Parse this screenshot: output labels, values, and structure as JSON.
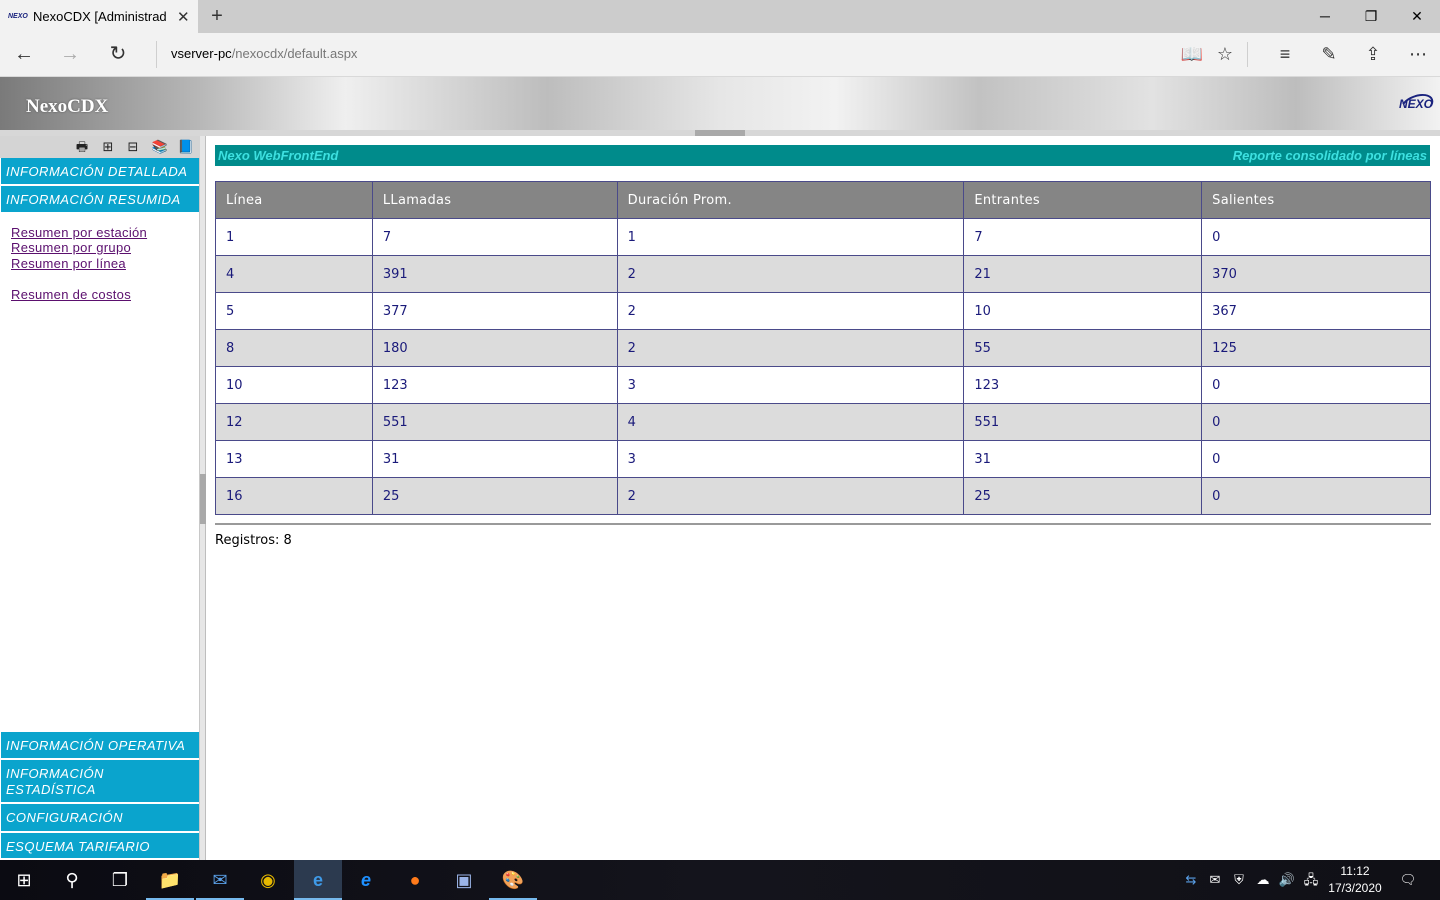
{
  "browser": {
    "tab_title": "NexoCDX [Administrado",
    "tab_favicon_text": "NEXO",
    "url_host": "vserver-pc",
    "url_path": "/nexocdx/default.aspx"
  },
  "header": {
    "app_title": "NexoCDX",
    "logo_text": "NEXO"
  },
  "sidebar": {
    "menu_top": [
      {
        "label": "INFORMACIÓN DETALLADA"
      },
      {
        "label": "INFORMACIÓN RESUMIDA"
      }
    ],
    "links": [
      {
        "label": "Resumen por estación"
      },
      {
        "label": "Resumen por grupo"
      },
      {
        "label": "Resumen por línea"
      },
      {
        "label": "Resumen de costos"
      }
    ],
    "menu_bottom": [
      {
        "label": "INFORMACIÓN OPERATIVA"
      },
      {
        "label": "INFORMACIÓN ESTADÍSTICA"
      },
      {
        "label": "CONFIGURACIÓN"
      },
      {
        "label": "ESQUEMA TARIFARIO"
      }
    ]
  },
  "report": {
    "left_label": "Nexo WebFrontEnd",
    "right_label": "Reporte consolidado por líneas",
    "columns": [
      "Línea",
      "LLamadas",
      "Duración Prom.",
      "Entrantes",
      "Salientes"
    ],
    "rows": [
      [
        "1",
        "7",
        "1",
        "7",
        "0"
      ],
      [
        "4",
        "391",
        "2",
        "21",
        "370"
      ],
      [
        "5",
        "377",
        "2",
        "10",
        "367"
      ],
      [
        "8",
        "180",
        "2",
        "55",
        "125"
      ],
      [
        "10",
        "123",
        "3",
        "123",
        "0"
      ],
      [
        "12",
        "551",
        "4",
        "551",
        "0"
      ],
      [
        "13",
        "31",
        "3",
        "31",
        "0"
      ],
      [
        "16",
        "25",
        "2",
        "25",
        "0"
      ]
    ],
    "record_count": "Registros: 8"
  },
  "taskbar": {
    "time": "11:12",
    "date": "17/3/2020"
  },
  "colors": {
    "menu_bar": "#0aa4cd",
    "report_bar": "#008b8b",
    "report_text": "#3de0e0",
    "table_header": "#858585",
    "row_alt": "#dcdcdc",
    "cell_text": "#1a1a7a",
    "link": "#5b0f6e"
  }
}
